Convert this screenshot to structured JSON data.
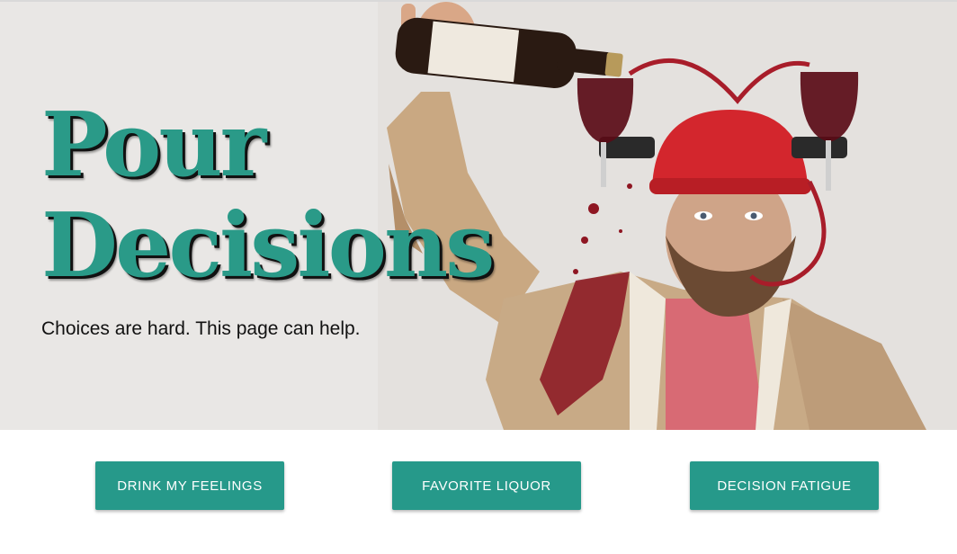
{
  "hero": {
    "title_line1": "Pour",
    "title_line2": "Decisions",
    "subtitle": "Choices are hard. This page can help.",
    "image": "man-wearing-wine-helmet-pouring-bottle-photo",
    "title_color": "#2a9a88"
  },
  "buttons": [
    {
      "label": "DRINK MY FEELINGS"
    },
    {
      "label": "FAVORITE LIQUOR"
    },
    {
      "label": "DECISION FATIGUE"
    }
  ],
  "colors": {
    "accent": "#26998a",
    "button_text": "#ffffff",
    "hero_background": "#e8e6e4"
  }
}
